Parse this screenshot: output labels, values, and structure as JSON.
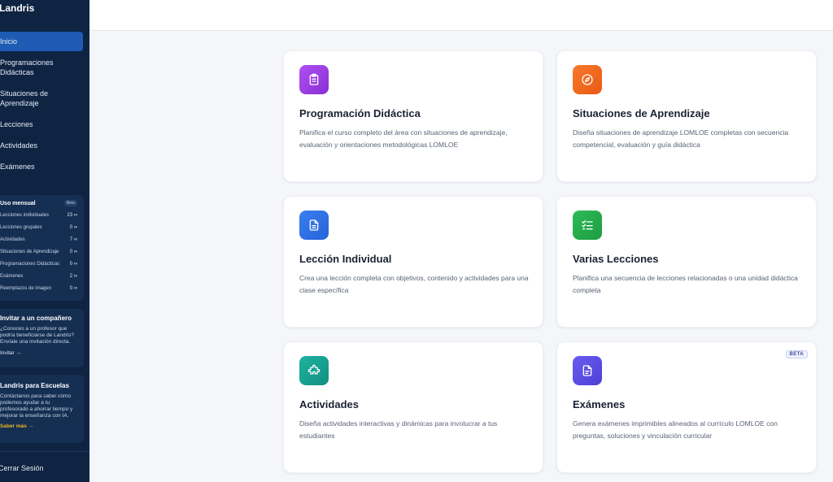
{
  "brand": "Landris",
  "nav": [
    {
      "label": "Inicio",
      "active": true
    },
    {
      "label": "Programaciones Didácticas"
    },
    {
      "label": "Situaciones de Aprendizaje"
    },
    {
      "label": "Lecciones"
    },
    {
      "label": "Actividades"
    },
    {
      "label": "Exámenes"
    }
  ],
  "usage": {
    "title": "Uso mensual",
    "badge": "Beta",
    "rows": [
      {
        "label": "Lecciones individuales",
        "value": "23 ∞"
      },
      {
        "label": "Lecciones grupales",
        "value": "0 ∞"
      },
      {
        "label": "Actividades",
        "value": "7 ∞"
      },
      {
        "label": "Situaciones de Aprendizaje",
        "value": "0 ∞"
      },
      {
        "label": "Programaciones Didácticas",
        "value": "0 ∞"
      },
      {
        "label": "Exámenes",
        "value": "2 ∞"
      },
      {
        "label": "Reemplazos de imagen",
        "value": "0 ∞"
      }
    ]
  },
  "invite": {
    "title": "Invitar a un compañero",
    "text": "¿Conoces a un profesor que podría beneficiarse de Landris? Envíale una invitación directa.",
    "link": "Invitar →"
  },
  "schools": {
    "title": "Landris para Escuelas",
    "text": "Contáctanos para saber cómo podemos ayudar a tu profesorado a ahorrar tiempo y mejorar la enseñanza con IA.",
    "link": "Saber más →"
  },
  "logout": "Cerrar Sesión",
  "cards": [
    {
      "title": "Programación Didáctica",
      "description": "Planifica el curso completo del área con situaciones de aprendizaje, evaluación y orientaciones metodológicas LOMLOE",
      "icon": "clipboard-icon",
      "color": "#9b3fe0"
    },
    {
      "title": "Situaciones de Aprendizaje",
      "description": "Diseña situaciones de aprendizaje LOMLOE completas con secuencia competencial, evaluación y guía didáctica",
      "icon": "compass-icon",
      "color": "#f26a1f"
    },
    {
      "title": "Lección Individual",
      "description": "Crea una lección completa con objetivos, contenido y actividades para una clase específica",
      "icon": "document-icon",
      "color": "#2f6fe6"
    },
    {
      "title": "Varias Lecciones",
      "description": "Planifica una secuencia de lecciones relacionadas o una unidad didáctica completa",
      "icon": "checklist-icon",
      "color": "#22a84a"
    },
    {
      "title": "Actividades",
      "description": "Diseña actividades interactivas y dinámicas para involucrar a tus estudiantes",
      "icon": "puzzle-icon",
      "color": "#17a392"
    },
    {
      "title": "Exámenes",
      "description": "Genera exámenes imprimibles alineados al currículo LOMLOE con preguntas, soluciones y vinculación curricular",
      "icon": "exam-document-icon",
      "color": "#5b4fe0",
      "badge": "BETA"
    }
  ]
}
